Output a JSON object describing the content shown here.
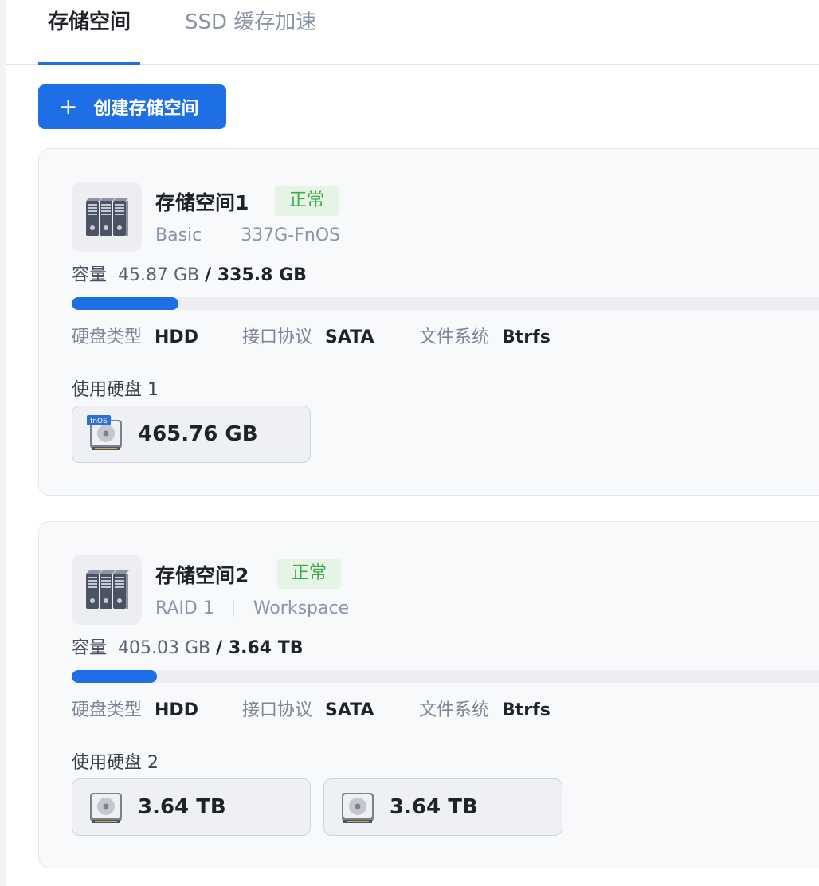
{
  "tabs": [
    {
      "label": "存储空间",
      "active": true
    },
    {
      "label": "SSD 缓存加速",
      "active": false
    }
  ],
  "create_button": {
    "plus": "+",
    "label": "创建存储空间"
  },
  "colors": {
    "accent": "#1e6ee6",
    "status_ok_bg": "#e6f4e6",
    "status_ok_text": "#3fa84f"
  },
  "pools": [
    {
      "name": "存储空间1",
      "status": "正常",
      "raid": "Basic",
      "volume": "337G-FnOS",
      "capacity_label": "容量",
      "used": "45.87 GB",
      "total": "/ 335.8 GB",
      "usage_fraction": 0.137,
      "attrs": [
        {
          "key": "硬盘类型",
          "value": "HDD"
        },
        {
          "key": "接口协议",
          "value": "SATA"
        },
        {
          "key": "文件系统",
          "value": "Btrfs"
        }
      ],
      "disks_label": "使用硬盘 1",
      "disks": [
        {
          "size": "465.76 GB",
          "badge": "fnOS",
          "icon": "hdd-icon"
        }
      ]
    },
    {
      "name": "存储空间2",
      "status": "正常",
      "raid": "RAID 1",
      "volume": "Workspace",
      "capacity_label": "容量",
      "used": "405.03 GB",
      "total": "/ 3.64 TB",
      "usage_fraction": 0.109,
      "attrs": [
        {
          "key": "硬盘类型",
          "value": "HDD"
        },
        {
          "key": "接口协议",
          "value": "SATA"
        },
        {
          "key": "文件系统",
          "value": "Btrfs"
        }
      ],
      "disks_label": "使用硬盘 2",
      "disks": [
        {
          "size": "3.64 TB",
          "icon": "hdd-icon"
        },
        {
          "size": "3.64 TB",
          "icon": "hdd-icon"
        }
      ]
    }
  ]
}
